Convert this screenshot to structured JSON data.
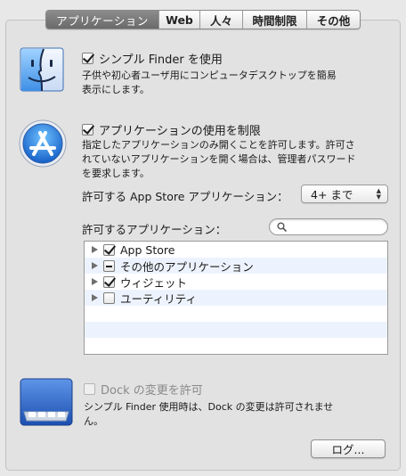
{
  "tabs": [
    {
      "label": "アプリケーション",
      "active": true
    },
    {
      "label": "Web",
      "active": false
    },
    {
      "label": "人々",
      "active": false
    },
    {
      "label": "時間制限",
      "active": false
    },
    {
      "label": "その他",
      "active": false
    }
  ],
  "finder_section": {
    "checkbox_label": "シンプル Finder を使用",
    "checked": true,
    "description_line1": "子供や初心者ユーザ用にコンピュータデスクトップを簡易",
    "description_line2": "表示にします。",
    "icon": "finder-icon"
  },
  "app_limit_section": {
    "checkbox_label": "アプリケーションの使用を制限",
    "checked": true,
    "description_line1": "指定したアプリケーションのみ開くことを許可します。許可さ",
    "description_line2": "れていないアプリケーションを開く場合は、管理者パスワード",
    "description_line3": "を要求します。",
    "icon": "app-store-icon",
    "appstore_label": "許可する App Store アプリケーション：",
    "appstore_select_value": "4+ まで",
    "allowed_apps_label": "許可するアプリケーション：",
    "search_placeholder": "",
    "apps": [
      {
        "label": "App Store",
        "state": "checked"
      },
      {
        "label": "その他のアプリケーション",
        "state": "mixed"
      },
      {
        "label": "ウィジェット",
        "state": "checked"
      },
      {
        "label": "ユーティリティ",
        "state": "unchecked"
      }
    ]
  },
  "dock_section": {
    "checkbox_label": "Dock の変更を許可",
    "checked": false,
    "enabled": false,
    "description_line1": "シンプル Finder 使用時は、Dock の変更は許可されませ",
    "description_line2": "ん。",
    "icon": "dock-icon"
  },
  "log_button_label": "ログ..."
}
